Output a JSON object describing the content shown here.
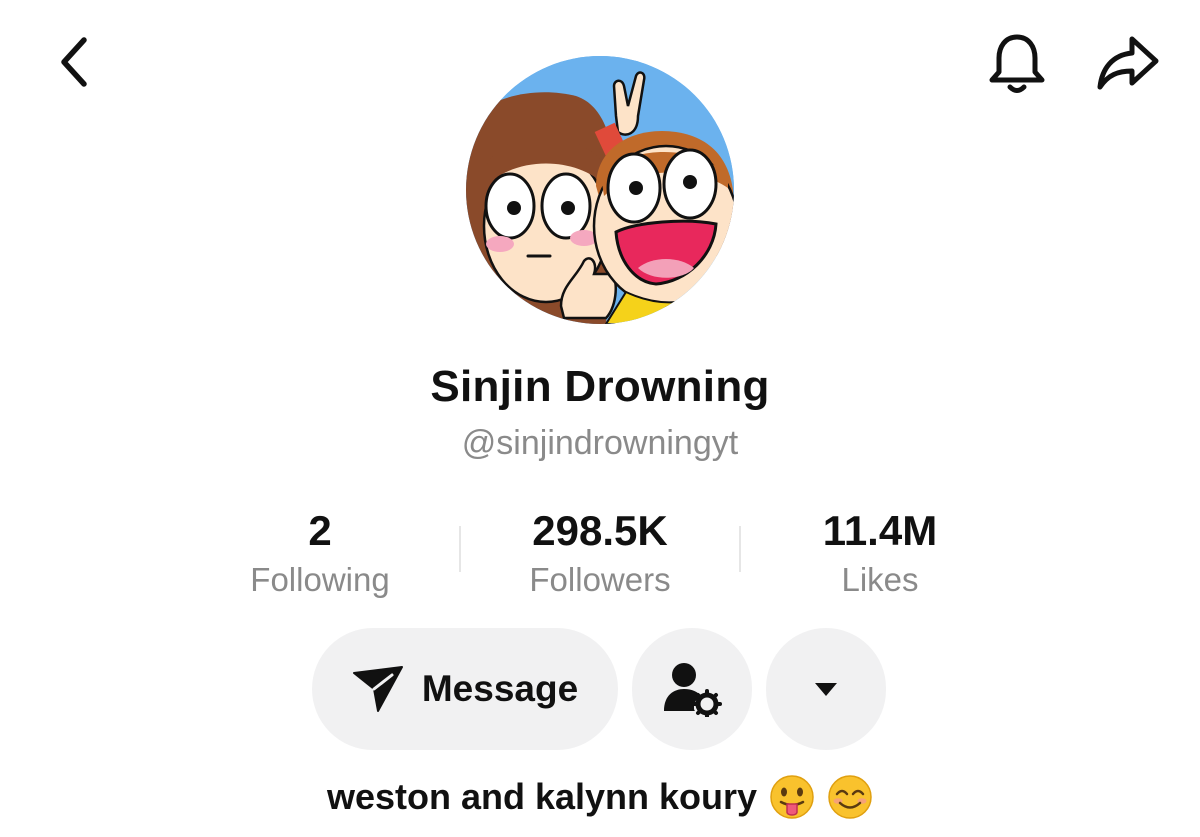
{
  "header": {
    "back_icon": "chevron-left-icon",
    "notification_icon": "bell-icon",
    "share_icon": "share-arrow-icon"
  },
  "profile": {
    "display_name": "Sinjin Drowning",
    "handle": "@sinjindrowningyt",
    "bio": "weston and kalynn koury",
    "bio_emojis": [
      "😛",
      "😊"
    ]
  },
  "stats": [
    {
      "value": "2",
      "label": "Following"
    },
    {
      "value": "298.5K",
      "label": "Followers"
    },
    {
      "value": "11.4M",
      "label": "Likes"
    }
  ],
  "actions": {
    "message_label": "Message",
    "message_icon": "send-icon",
    "friend_icon": "user-settings-icon",
    "more_icon": "caret-down-icon"
  },
  "colors": {
    "text_primary": "#111111",
    "text_secondary": "#8a8a8a",
    "button_bg": "#f1f1f2",
    "avatar_bg": "#6bb2ee"
  }
}
